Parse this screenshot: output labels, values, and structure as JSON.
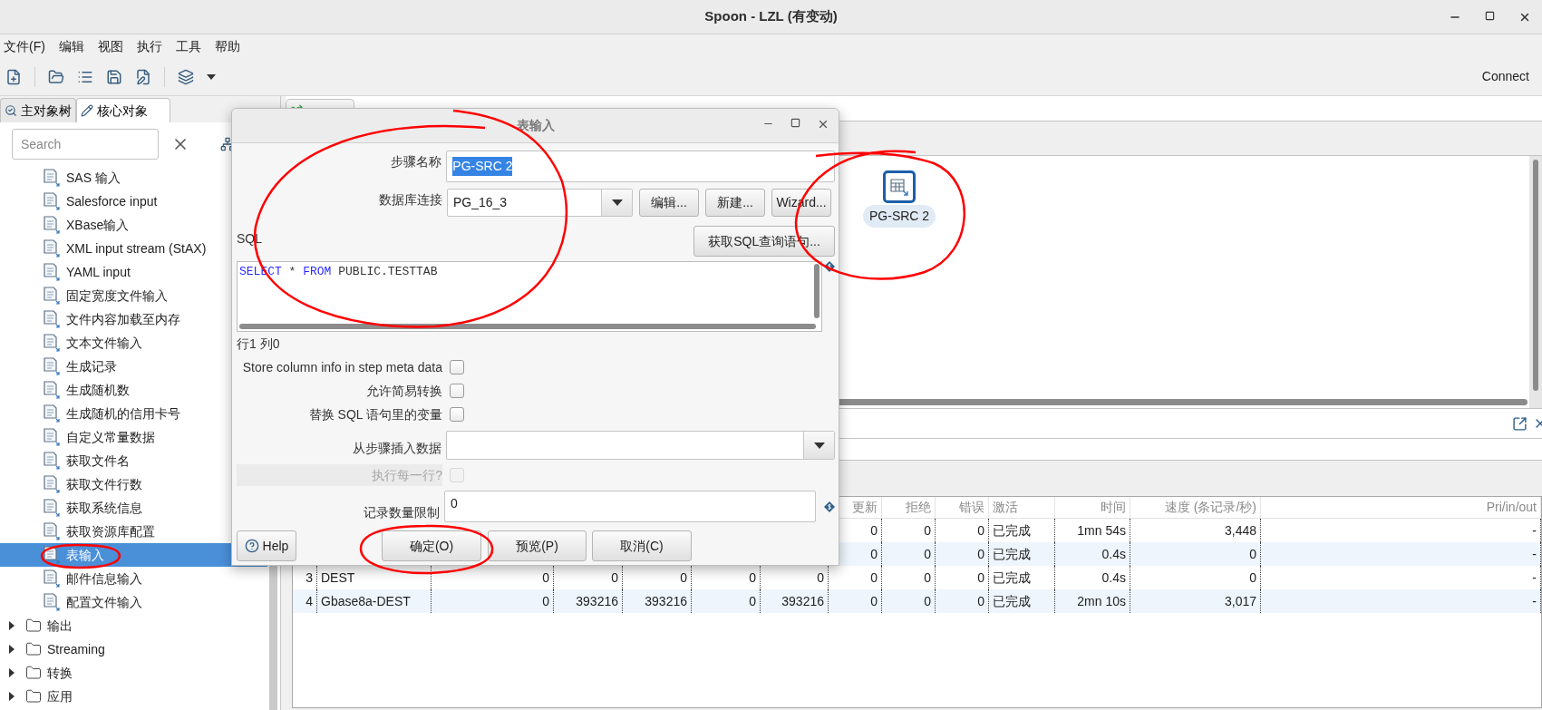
{
  "window": {
    "title": "Spoon - LZL (有变动)"
  },
  "menu": [
    "文件(F)",
    "编辑",
    "视图",
    "执行",
    "工具",
    "帮助"
  ],
  "toolbar": {
    "connect": "Connect"
  },
  "left_panel": {
    "tabs": [
      {
        "label": "主对象树",
        "selected": false,
        "kind": "tree"
      },
      {
        "label": "核心对象",
        "selected": true,
        "kind": "pencil"
      }
    ],
    "search": {
      "placeholder": "Search"
    },
    "open_folder_steps": [
      {
        "label": "SAS 输入",
        "selected": false
      },
      {
        "label": "Salesforce input",
        "selected": false
      },
      {
        "label": "XBase输入",
        "selected": false
      },
      {
        "label": "XML input stream (StAX)",
        "selected": false
      },
      {
        "label": "YAML input",
        "selected": false
      },
      {
        "label": "固定宽度文件输入",
        "selected": false
      },
      {
        "label": "文件内容加载至内存",
        "selected": false
      },
      {
        "label": "文本文件输入",
        "selected": false
      },
      {
        "label": "生成记录",
        "selected": false
      },
      {
        "label": "生成随机数",
        "selected": false
      },
      {
        "label": "生成随机的信用卡号",
        "selected": false
      },
      {
        "label": "自定义常量数据",
        "selected": false
      },
      {
        "label": "获取文件名",
        "selected": false
      },
      {
        "label": "获取文件行数",
        "selected": false
      },
      {
        "label": "获取系统信息",
        "selected": false
      },
      {
        "label": "获取资源库配置",
        "selected": false
      },
      {
        "label": "表输入",
        "selected": true
      },
      {
        "label": "邮件信息输入",
        "selected": false
      },
      {
        "label": "配置文件输入",
        "selected": false
      }
    ],
    "folders": [
      {
        "label": "输出",
        "expanded": false
      },
      {
        "label": "Streaming",
        "expanded": false
      },
      {
        "label": "转换",
        "expanded": false
      },
      {
        "label": "应用",
        "expanded": false
      }
    ]
  },
  "canvas": {
    "node": {
      "label": "PG-SRC 2"
    }
  },
  "results": {
    "headers": {
      "updated": "更新",
      "rejected": "拒绝",
      "errors": "错误",
      "active": "激活",
      "time": "时间",
      "speed": "速度 (条记录/秒)",
      "pri_in_out": "Pri/in/out"
    },
    "rows": [
      {
        "updated": "0",
        "rejected": "0",
        "errors": "0",
        "active": "已完成",
        "time": "1mn 54s",
        "speed": "3,448",
        "pri_in_out": "-"
      },
      {
        "updated": "0",
        "rejected": "0",
        "errors": "0",
        "active": "已完成",
        "time": "0.4s",
        "speed": "0",
        "pri_in_out": "-"
      },
      {
        "index": "3",
        "step": "DEST",
        "column_3": "0",
        "column_4": "0",
        "column_5": "0",
        "column_6": "0",
        "column_7": "0",
        "updated": "0",
        "rejected": "0",
        "errors": "0",
        "active": "已完成",
        "time": "0.4s",
        "speed": "0",
        "pri_in_out": "-"
      },
      {
        "index": "4",
        "step": "Gbase8a-DEST",
        "column_3": "0",
        "column_4": "393216",
        "column_5": "393216",
        "column_6": "0",
        "column_7": "393216",
        "updated": "0",
        "rejected": "0",
        "errors": "0",
        "active": "已完成",
        "time": "2mn 10s",
        "speed": "3,017",
        "pri_in_out": "-"
      }
    ]
  },
  "dialog": {
    "title": "表输入",
    "step_name": {
      "label": "步骤名称",
      "value": "PG-SRC 2",
      "text_selected": true
    },
    "connection": {
      "label": "数据库连接",
      "value": "PG_16_3",
      "buttons": [
        "编辑...",
        "新建...",
        "Wizard..."
      ]
    },
    "sql_label": "SQL",
    "get_sql_button": "获取SQL查询语句...",
    "sql": [
      {
        "text": "SELECT",
        "kind": "keyword"
      },
      {
        "text": " * ",
        "kind": "plain"
      },
      {
        "text": "FROM",
        "kind": "keyword"
      },
      {
        "text": " PUBLIC.TESTTAB",
        "kind": "plain"
      }
    ],
    "cursor_position": "行1 列0",
    "options": [
      {
        "kind": "checkbox",
        "label": "Store column info in step meta data",
        "checked": false,
        "disabled": false
      },
      {
        "kind": "checkbox",
        "label": "允许简易转换",
        "checked": false,
        "disabled": false
      },
      {
        "kind": "checkbox",
        "label": "替换 SQL 语句里的变量",
        "checked": false,
        "disabled": false
      },
      {
        "kind": "select",
        "label": "从步骤插入数据"
      },
      {
        "kind": "checkbox",
        "label": "执行每一行?",
        "checked": false,
        "disabled": true
      }
    ],
    "limit": {
      "label": "记录数量限制",
      "value": "0"
    },
    "buttons": {
      "help": "Help",
      "ok": "确定(O)",
      "preview": "预览(P)",
      "cancel": "取消(C)"
    }
  }
}
